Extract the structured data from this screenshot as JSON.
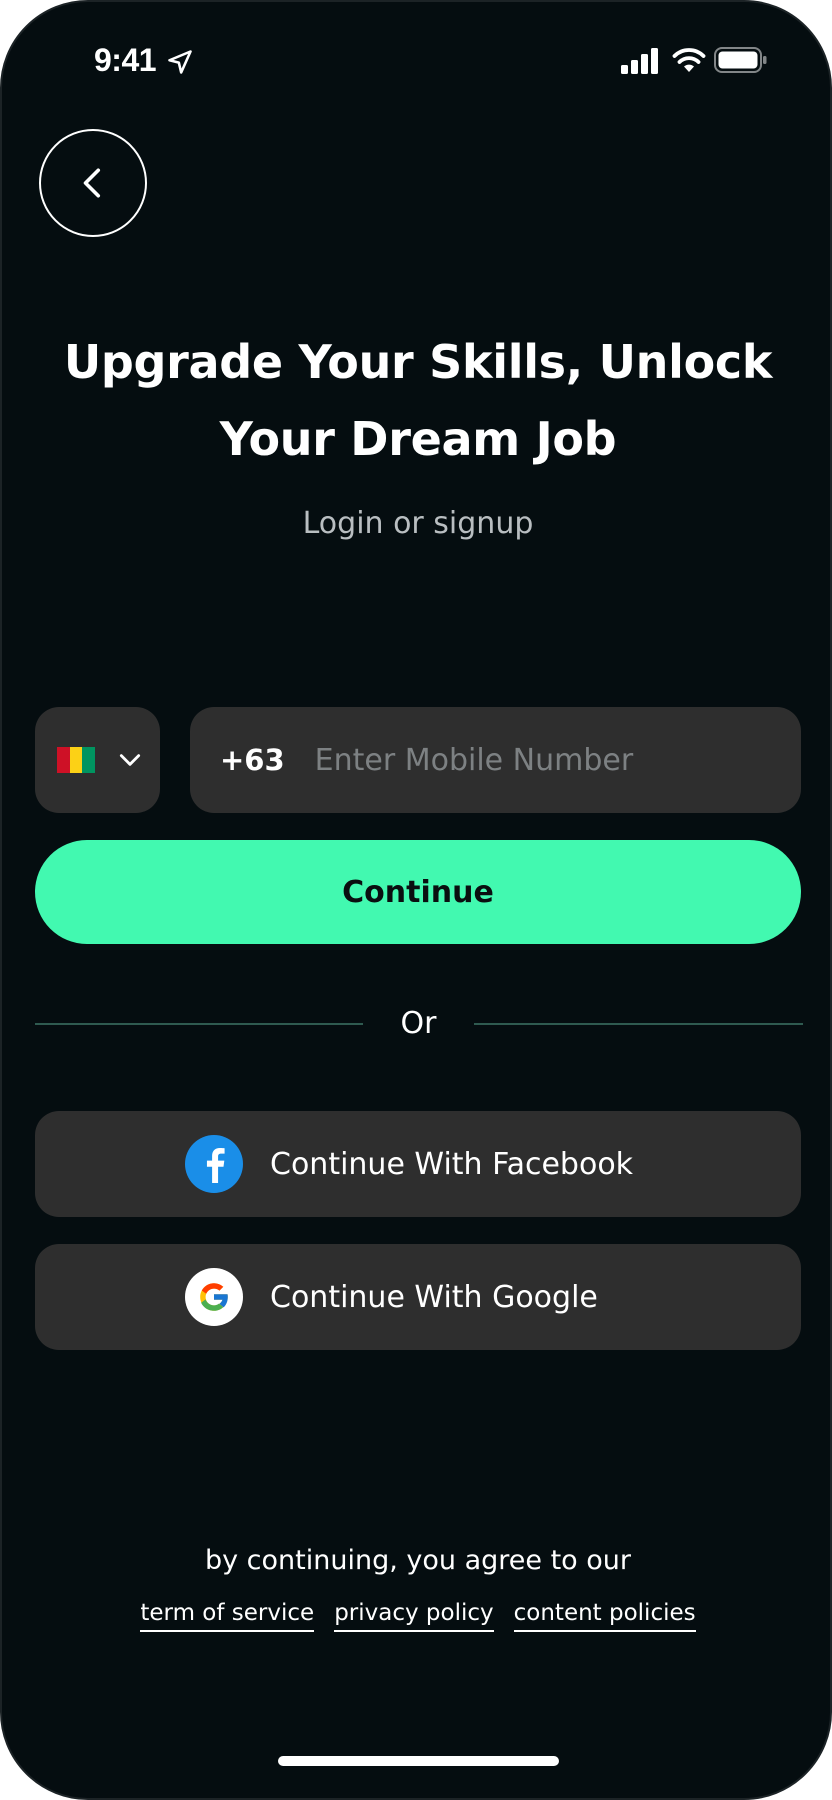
{
  "status_bar": {
    "time": "9:41",
    "icons": [
      "location-arrow-icon",
      "cellular-signal-icon",
      "wifi-icon",
      "battery-icon"
    ]
  },
  "back_button": {
    "icon": "chevron-left-icon"
  },
  "headline": {
    "line1": "Upgrade Your Skills, Unlock",
    "line2": "Your Dream Job"
  },
  "subtitle": "Login or signup",
  "phone_entry": {
    "flag_icon": "flag-icon",
    "flag_colors": [
      "#ce1126",
      "#fcd116",
      "#009460"
    ],
    "dial_code": "+63",
    "placeholder": "Enter Mobile Number",
    "value": ""
  },
  "continue_label": "Continue",
  "divider_label": "Or",
  "social": {
    "facebook_label": "Continue With Facebook",
    "google_label": "Continue With Google"
  },
  "terms": {
    "intro": "by continuing, you agree to our",
    "links": [
      "term of service",
      "privacy policy",
      "content policies"
    ]
  },
  "colors": {
    "background": "#050d10",
    "accent": "#42f9b0",
    "surface": "#2e2e2e",
    "facebook": "#1a8ee8"
  }
}
